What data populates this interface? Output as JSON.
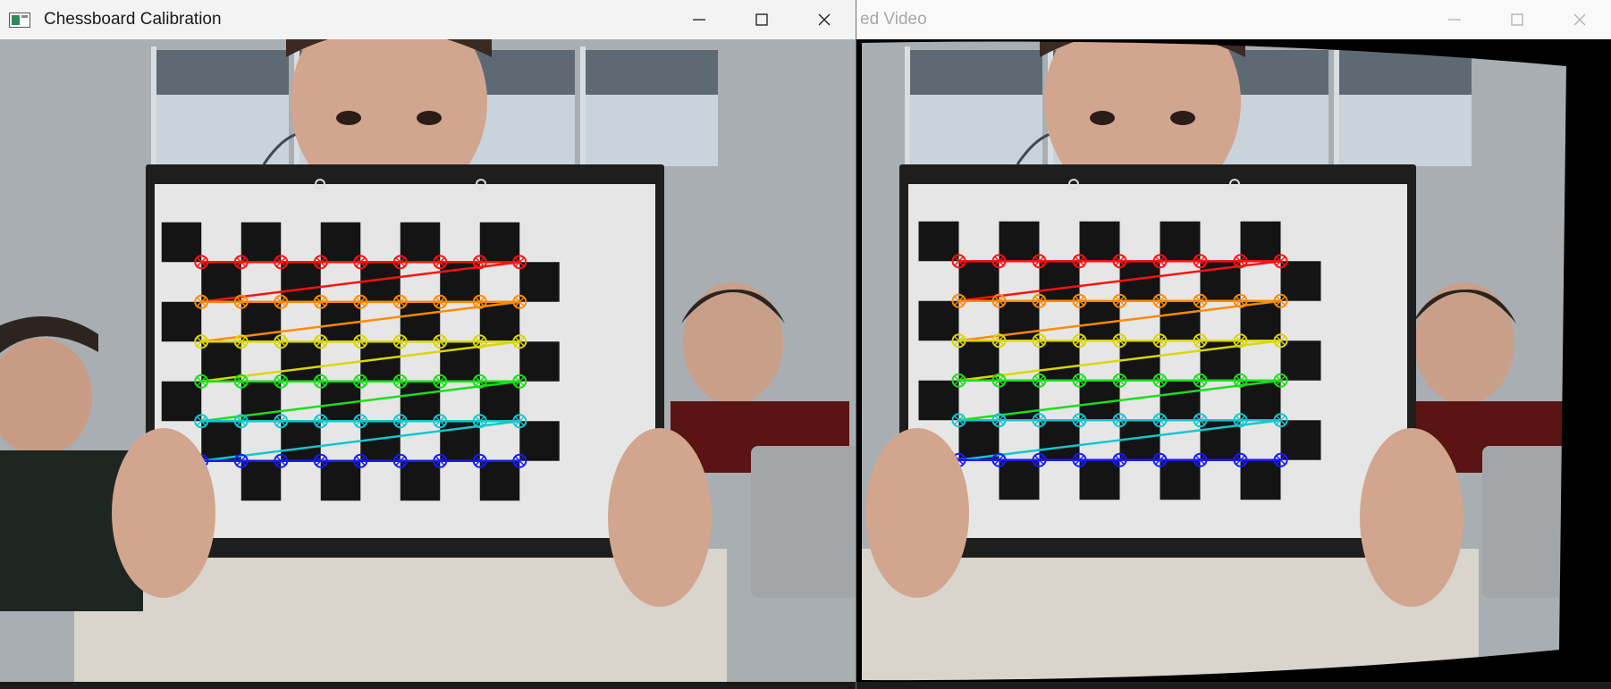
{
  "windows": [
    {
      "id": "left",
      "title": "Chessboard Calibration",
      "active": true,
      "controls": [
        "minimize-icon",
        "maximize-icon",
        "close-icon"
      ]
    },
    {
      "id": "right",
      "title": "ed Video",
      "active": false,
      "controls": [
        "minimize-icon",
        "maximize-icon",
        "close-icon"
      ]
    }
  ],
  "chessboard": {
    "inner_corners_cols": 9,
    "inner_corners_rows": 6,
    "row_colors": [
      "#ff1010",
      "#ff8a00",
      "#d8d800",
      "#18e018",
      "#10c8d0",
      "#1818ff"
    ]
  },
  "colors": {
    "paper": "#e6e6e6",
    "board_frame": "#1e1e1e",
    "square": "#141414",
    "wall": "#a9aeb2",
    "window_glass": "#c9d3dc",
    "sweater": "#d9d5cc",
    "skin": "#d2a58f"
  }
}
